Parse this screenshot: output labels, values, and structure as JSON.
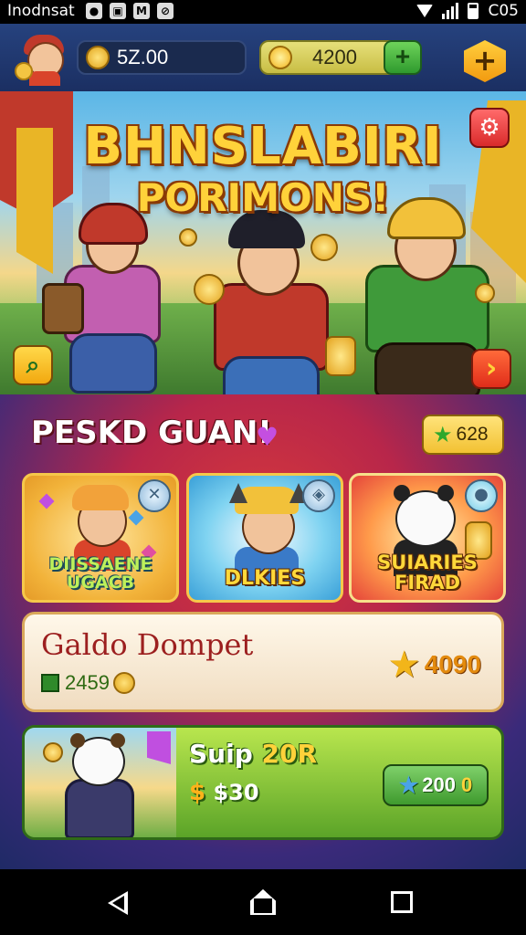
{
  "status_bar": {
    "carrier": "Inodnsat",
    "icons": [
      "notification-icon",
      "photo-icon",
      "mail-icon",
      "blocked-icon"
    ],
    "time": "C05"
  },
  "top_bar": {
    "coins": "5Z.00",
    "gems": "4200",
    "add_gems_label": "+",
    "add_label": "+"
  },
  "hero": {
    "title_line1": "BHNSLABIRI",
    "title_line2": "PORIMONS!",
    "next_label": "›"
  },
  "section": {
    "title": "PESKD GUAN!",
    "heart": "♥",
    "stars": "628"
  },
  "cards": [
    {
      "label_line1": "DIISSAENE",
      "label_line2": "UGACB"
    },
    {
      "label_line1": "DLKIES",
      "label_line2": ""
    },
    {
      "label_line1": "SUIARIES",
      "label_line2": "FIRAD"
    }
  ],
  "offer": {
    "name": "Galdo Dompet",
    "sub_value": "2459",
    "price": "4090"
  },
  "promo": {
    "title_main": "Suip",
    "title_highlight": "20R",
    "price_symbol": "$",
    "price": "$30",
    "button_value": "200",
    "button_extra": "0"
  },
  "colors": {
    "accent_gold": "#ffd23a",
    "brand_red": "#d83a3a",
    "promo_green": "#5ba428",
    "offer_text": "#9c1f1f"
  }
}
